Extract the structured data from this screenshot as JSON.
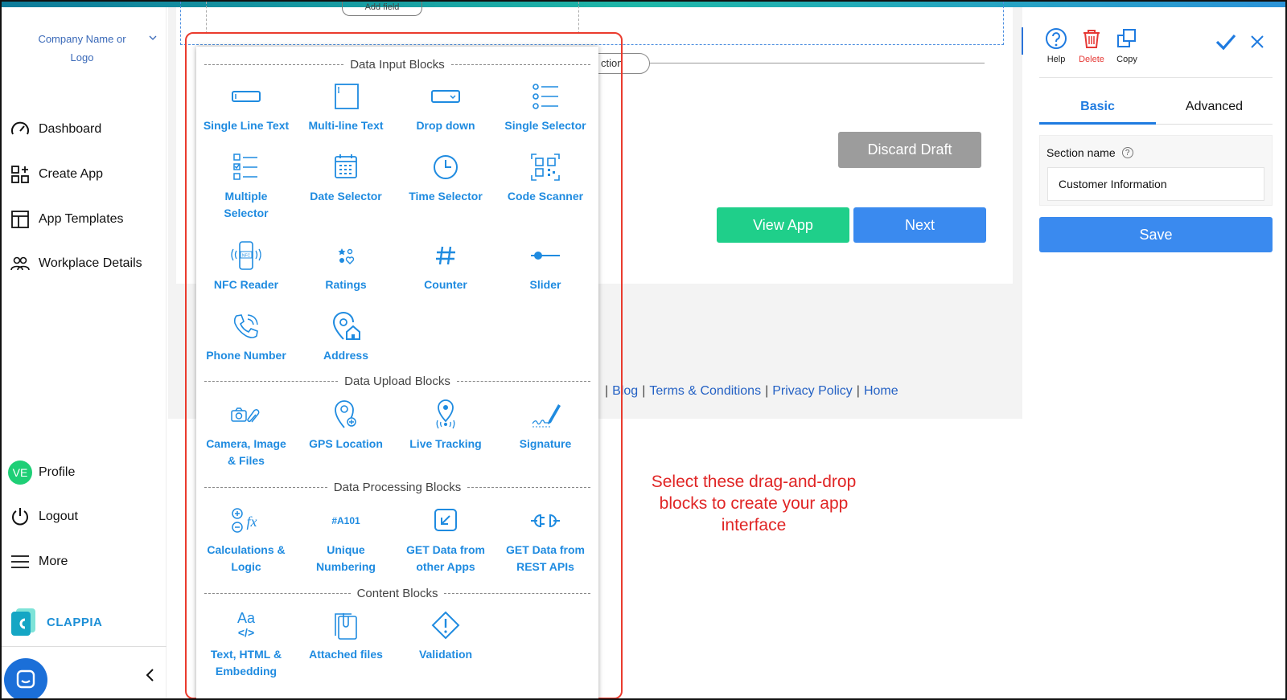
{
  "sidebar": {
    "company_line1": "Company Name or",
    "company_line2": "Logo",
    "nav": [
      "Dashboard",
      "Create App",
      "App Templates",
      "Workplace Details"
    ],
    "profile_initials": "VE",
    "profile": "Profile",
    "logout": "Logout",
    "more": "More",
    "brand": "CLAPPIA"
  },
  "canvas": {
    "add_field": "Add field",
    "section_pill": "ction",
    "discard_draft": "Discard Draft",
    "view_app": "View App",
    "next": "Next",
    "footer_links": [
      "Blog",
      "Terms & Conditions",
      "Privacy Policy",
      "Home"
    ],
    "caption": "Select these drag-and-drop blocks to create your app interface"
  },
  "blocks_panel": {
    "groups": [
      {
        "title": "Data Input Blocks",
        "blocks": [
          {
            "label1": "Single Line Text",
            "label2": ""
          },
          {
            "label1": "Multi-line Text",
            "label2": ""
          },
          {
            "label1": "Drop down",
            "label2": ""
          },
          {
            "label1": "Single Selector",
            "label2": ""
          },
          {
            "label1": "Multiple",
            "label2": "Selector"
          },
          {
            "label1": "Date Selector",
            "label2": ""
          },
          {
            "label1": "Time Selector",
            "label2": ""
          },
          {
            "label1": "Code Scanner",
            "label2": ""
          },
          {
            "label1": "NFC Reader",
            "label2": ""
          },
          {
            "label1": "Ratings",
            "label2": ""
          },
          {
            "label1": "Counter",
            "label2": ""
          },
          {
            "label1": "Slider",
            "label2": ""
          },
          {
            "label1": "Phone Number",
            "label2": ""
          },
          {
            "label1": "Address",
            "label2": ""
          }
        ]
      },
      {
        "title": "Data Upload Blocks",
        "blocks": [
          {
            "label1": "Camera, Image",
            "label2": "& Files"
          },
          {
            "label1": "GPS Location",
            "label2": ""
          },
          {
            "label1": "Live Tracking",
            "label2": ""
          },
          {
            "label1": "Signature",
            "label2": ""
          }
        ]
      },
      {
        "title": "Data Processing Blocks",
        "blocks": [
          {
            "label1": "Calculations &",
            "label2": "Logic"
          },
          {
            "label1": "Unique",
            "label2": "Numbering",
            "icon_text": "#A101"
          },
          {
            "label1": "GET Data from",
            "label2": "other Apps"
          },
          {
            "label1": "GET Data from",
            "label2": "REST APIs"
          }
        ]
      },
      {
        "title": "Content Blocks",
        "blocks": [
          {
            "label1": "Text, HTML &",
            "label2": "Embedding",
            "icon_text": "Aa"
          },
          {
            "label1": "Attached files",
            "label2": ""
          },
          {
            "label1": "Validation",
            "label2": ""
          }
        ]
      }
    ]
  },
  "properties": {
    "help": "Help",
    "delete": "Delete",
    "copy": "Copy",
    "tab_basic": "Basic",
    "tab_advanced": "Advanced",
    "section_name_label": "Section name",
    "help_mark": "?",
    "section_name_value": "Customer Information",
    "save": "Save"
  },
  "colors": {
    "accent_blue": "#3a8aef",
    "block_blue": "#1f8be0",
    "green": "#1fcf8a",
    "highlight_red": "#ea3b2e",
    "delete_red": "#e53935"
  }
}
